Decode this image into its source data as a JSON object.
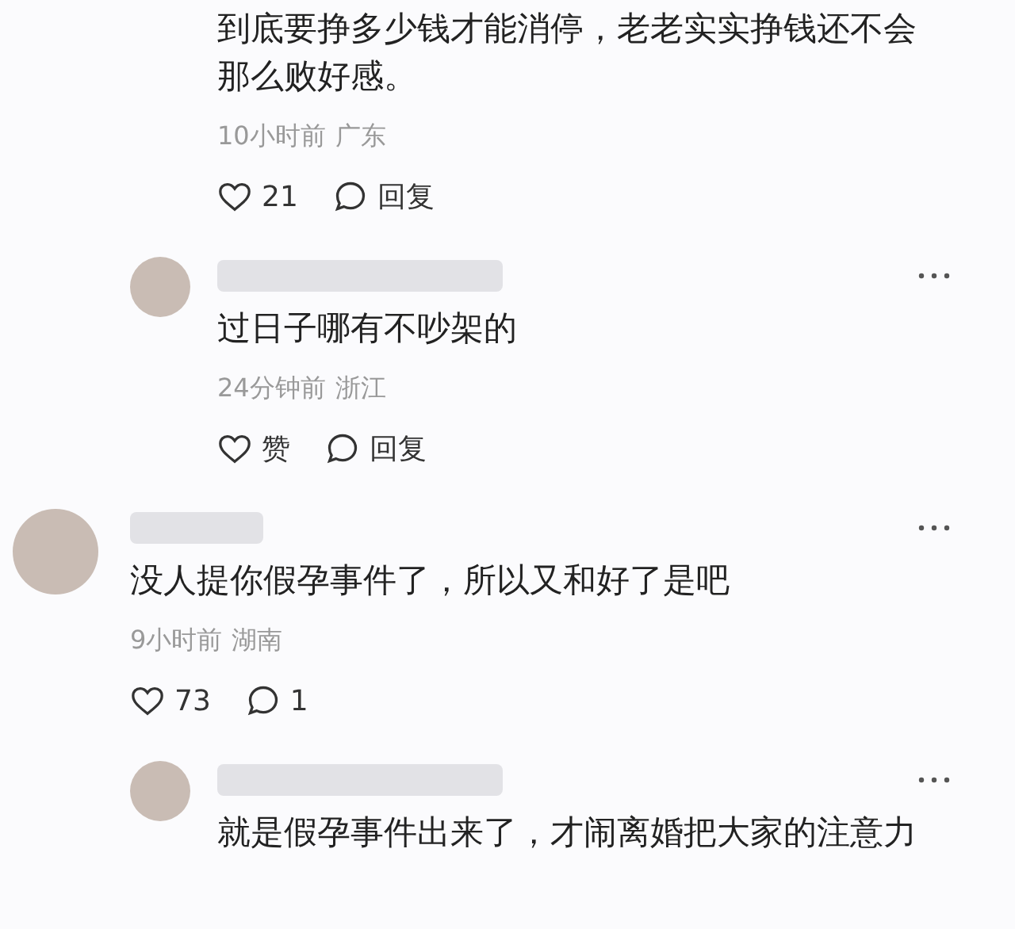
{
  "comments": [
    {
      "kind": "reply",
      "header_visible": false,
      "text": "到底要挣多少钱才能消停，老老实实挣钱还不会那么败好感。",
      "time": "10小时前",
      "location": "广东",
      "like_label": "21",
      "reply_label": "回复"
    },
    {
      "kind": "reply",
      "header_visible": true,
      "text": "过日子哪有不吵架的",
      "time": "24分钟前",
      "location": "浙江",
      "like_label": "赞",
      "reply_label": "回复"
    },
    {
      "kind": "top",
      "header_visible": true,
      "text": "没人提你假孕事件了，所以又和好了是吧",
      "time": "9小时前",
      "location": "湖南",
      "like_label": "73",
      "reply_label": "1"
    },
    {
      "kind": "reply",
      "header_visible": true,
      "text": "就是假孕事件出来了，才闹离婚把大家的注意力"
    }
  ]
}
